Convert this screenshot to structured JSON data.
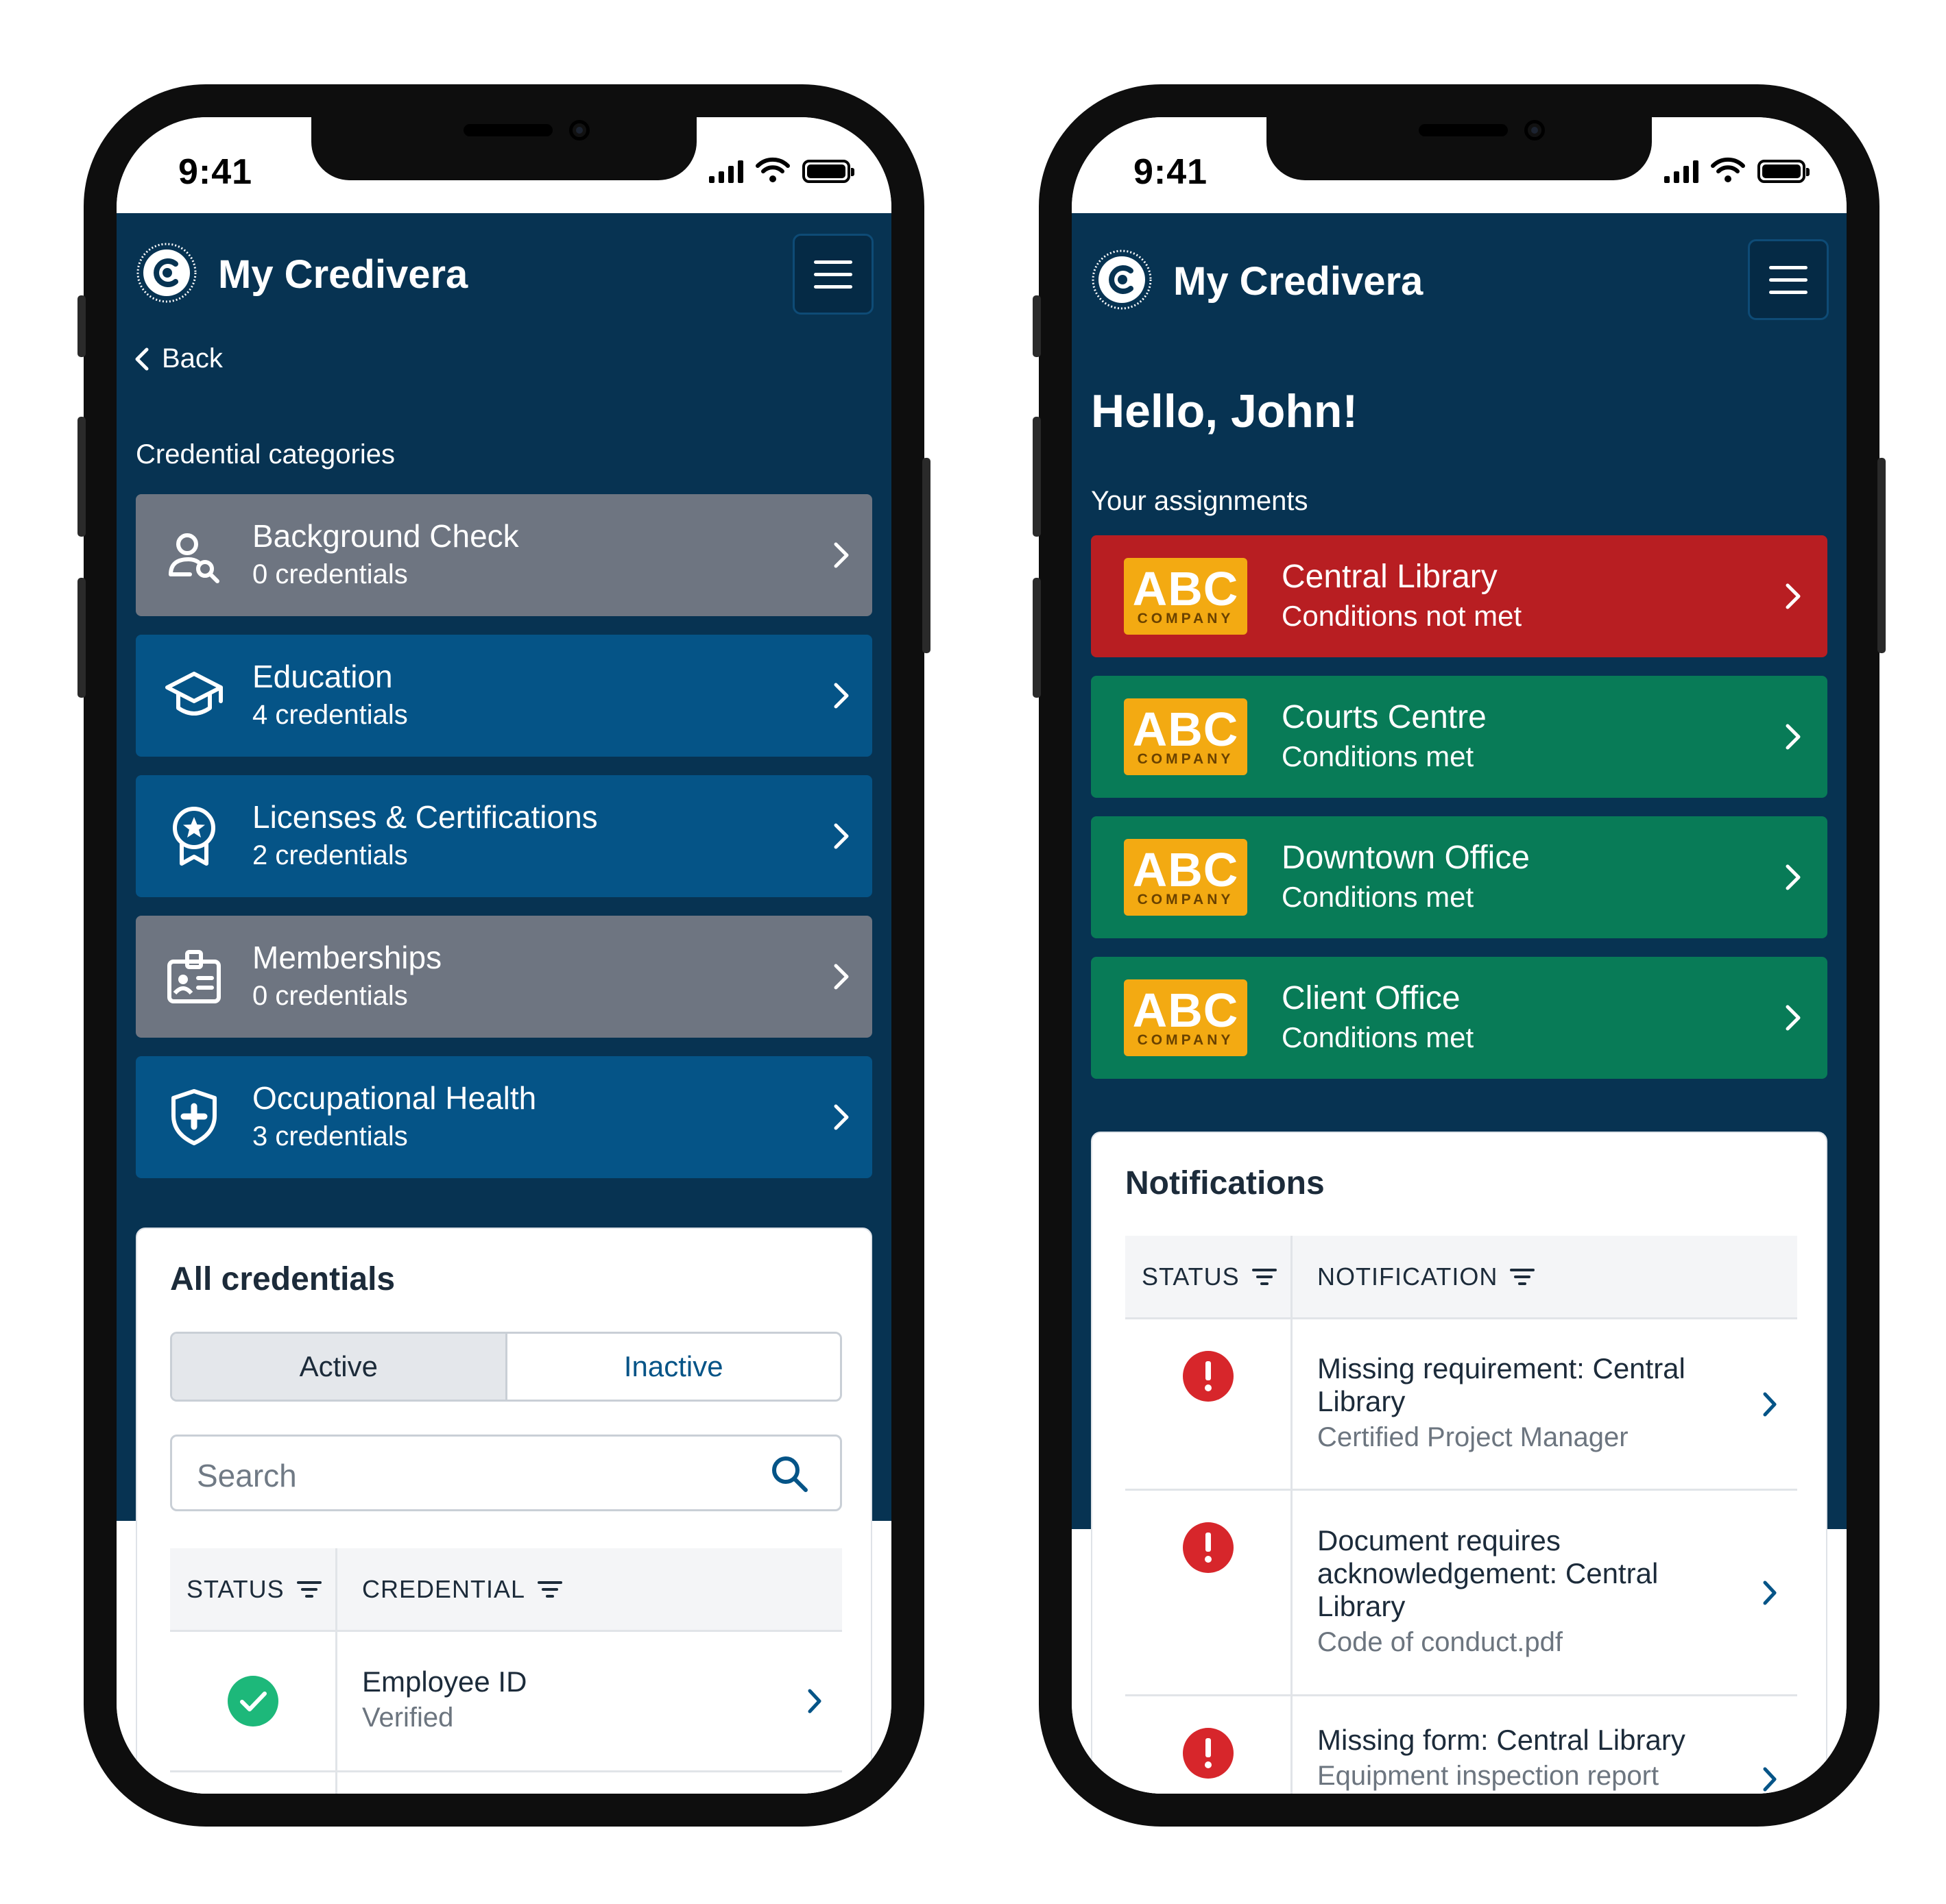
{
  "left_phone": {
    "status_bar": {
      "time": "9:41"
    },
    "app_bar": {
      "title": "My Credivera",
      "logo_icon": "credivera-logo-icon",
      "menu_icon": "hamburger-menu-icon"
    },
    "back_label": "Back",
    "section_label": "Credential categories",
    "categories": [
      {
        "name": "Background Check",
        "count": "0 credentials",
        "icon": "person-search-icon",
        "color": "#6e7581"
      },
      {
        "name": "Education",
        "count": "4 credentials",
        "icon": "graduation-cap-icon",
        "color": "#055487"
      },
      {
        "name": "Licenses & Certifications",
        "count": "2 credentials",
        "icon": "award-badge-icon",
        "color": "#055487"
      },
      {
        "name": "Memberships",
        "count": "0 credentials",
        "icon": "id-badge-icon",
        "color": "#6e7581"
      },
      {
        "name": "Occupational Health",
        "count": "3 credentials",
        "icon": "health-shield-icon",
        "color": "#055487"
      }
    ],
    "all_credentials": {
      "title": "All credentials",
      "tabs": {
        "active": "Active",
        "inactive": "Inactive",
        "selected": "Active"
      },
      "search_placeholder": "Search",
      "columns": {
        "status": "STATUS",
        "credential": "CREDENTIAL"
      },
      "rows": [
        {
          "status_icon": "check-circle-icon",
          "title": "Employee ID",
          "detail": "Verified"
        }
      ]
    }
  },
  "right_phone": {
    "status_bar": {
      "time": "9:41"
    },
    "app_bar": {
      "title": "My Credivera"
    },
    "greeting": "Hello, John!",
    "assignments_label": "Your assignments",
    "assignments": [
      {
        "logo_text": "ABC",
        "logo_subtext": "COMPANY",
        "name": "Central Library",
        "status": "Conditions not met",
        "color": "#b81e22"
      },
      {
        "logo_text": "ABC",
        "logo_subtext": "COMPANY",
        "name": "Courts Centre",
        "status": "Conditions met",
        "color": "#087b57"
      },
      {
        "logo_text": "ABC",
        "logo_subtext": "COMPANY",
        "name": "Downtown Office",
        "status": "Conditions met",
        "color": "#087b57"
      },
      {
        "logo_text": "ABC",
        "logo_subtext": "COMPANY",
        "name": "Client Office",
        "status": "Conditions met",
        "color": "#087b57"
      }
    ],
    "notifications": {
      "title": "Notifications",
      "columns": {
        "status": "STATUS",
        "notification": "NOTIFICATION"
      },
      "rows": [
        {
          "status_icon": "error-alert-icon",
          "title": "Missing requirement: Central Library",
          "detail": "Certified Project Manager"
        },
        {
          "status_icon": "error-alert-icon",
          "title": "Document requires acknowledgement:  Central Library",
          "detail": "Code of conduct.pdf"
        },
        {
          "status_icon": "error-alert-icon",
          "title": "Missing form: Central Library",
          "detail": "Equipment inspection report"
        }
      ]
    }
  },
  "colors": {
    "navy": "#073352",
    "error_red": "#d7262b",
    "success_green": "#1db87a",
    "link_blue": "#055487",
    "abc_gold": "#f3aa12"
  }
}
